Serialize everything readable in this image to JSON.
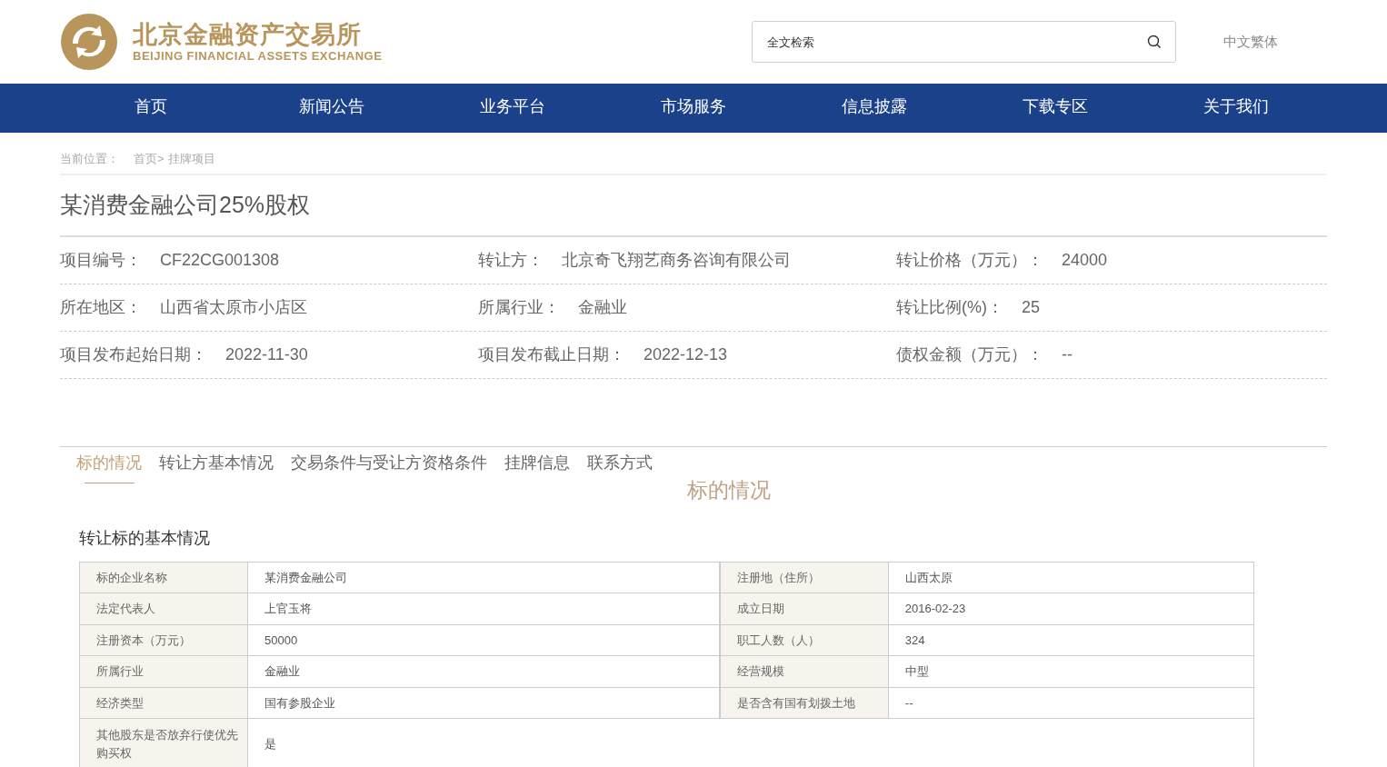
{
  "header": {
    "logo_cn": "北京金融资产交易所",
    "logo_en": "BEIJING FINANCIAL ASSETS EXCHANGE",
    "search": {
      "placeholder": "全文检索"
    },
    "language": "中文繁体"
  },
  "nav": [
    "首页",
    "新闻公告",
    "业务平台",
    "市场服务",
    "信息披露",
    "下载专区",
    "关于我们"
  ],
  "breadcrumb": {
    "label": "当前位置：",
    "items": [
      "首页>",
      "挂牌项目"
    ]
  },
  "title": "某消费金融公司25%股权",
  "summary": [
    [
      {
        "label": "项目编号：",
        "value": "CF22CG001308"
      },
      {
        "label": "转让方：",
        "value": "北京奇飞翔艺商务咨询有限公司"
      },
      {
        "label": "转让价格（万元）：",
        "value": "24000"
      }
    ],
    [
      {
        "label": "所在地区：",
        "value": "山西省太原市小店区"
      },
      {
        "label": "所属行业：",
        "value": "金融业"
      },
      {
        "label": "转让比例(%)：",
        "value": "25"
      }
    ],
    [
      {
        "label": "项目发布起始日期：",
        "value": "2022-11-30"
      },
      {
        "label": "项目发布截止日期：",
        "value": "2022-12-13"
      },
      {
        "label": "债权金额（万元）：",
        "value": "--"
      }
    ]
  ],
  "tabs": [
    {
      "label": "标的情况",
      "selected": true
    },
    {
      "label": "转让方基本情况",
      "selected": false
    },
    {
      "label": "交易条件与受让方资格条件",
      "selected": false
    },
    {
      "label": "挂牌信息",
      "selected": false
    },
    {
      "label": "联系方式",
      "selected": false
    }
  ],
  "section_title": "标的情况",
  "subsection_title": "转让标的基本情况",
  "table": [
    [
      {
        "label": "标的企业名称",
        "value": "某消费金融公司"
      },
      {
        "label": "注册地（住所）",
        "value": "山西太原"
      }
    ],
    [
      {
        "label": "法定代表人",
        "value": "上官玉将"
      },
      {
        "label": "成立日期",
        "value": "2016-02-23"
      }
    ],
    [
      {
        "label": "注册资本（万元）",
        "value": "50000"
      },
      {
        "label": "职工人数（人）",
        "value": "324"
      }
    ],
    [
      {
        "label": "所属行业",
        "value": "金融业"
      },
      {
        "label": "经营规模",
        "value": "中型"
      }
    ],
    [
      {
        "label": "经济类型",
        "value": "国有参股企业"
      },
      {
        "label": "是否含有国有划拨土地",
        "value": "--"
      }
    ],
    [
      {
        "label": "其他股东是否放弃行使优先购买权",
        "value": "是"
      }
    ]
  ]
}
